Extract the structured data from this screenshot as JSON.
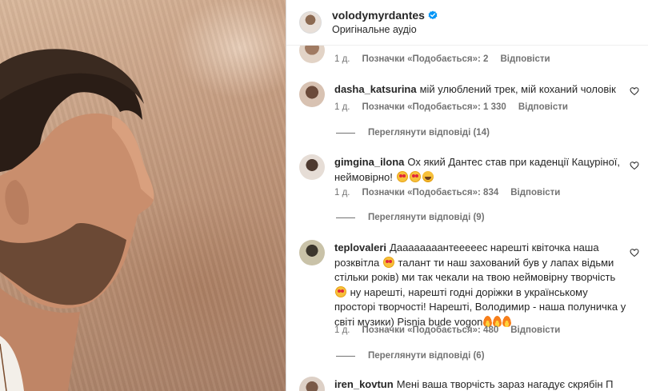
{
  "post": {
    "username": "volodymyrdantes",
    "subtitle": "Оригінальне аудіо"
  },
  "labels": {
    "time": "1 д.",
    "reply": "Відповісти"
  },
  "top_partial": {
    "likes": "Позначки «Подобається»: 2"
  },
  "comments": [
    {
      "username": "dasha_katsurina",
      "text": "мій улюблений трек, мій коханий чоловік",
      "time": "1 д.",
      "likes": "Позначки «Подобається»: 1 330",
      "reply": "Відповісти",
      "view_replies": "Переглянути відповіді (14)"
    },
    {
      "username": "gimgina_ilona",
      "text": "Ох який Дантес став при каденції Кацуріної, неймовірно!",
      "emoji": [
        "heart-eyes",
        "heart-eyes",
        "laugh"
      ],
      "time": "1 д.",
      "likes": "Позначки «Подобається»: 834",
      "reply": "Відповісти",
      "view_replies": "Переглянути відповіді (9)"
    },
    {
      "username": "teplovaleri",
      "text_1": "Даааааааантееееес нарешті квіточка наша розквітла",
      "text_2": "талант ти наш захований був у лапах відьми стільки років) ми так чекали на твою неймовірну творчість",
      "text_3": "ну нарешті, нарешті годні доріжки в українському просторі творчості! Нарешті, Володимир - наша полуничка у світі музики) Pisnia bude vogon",
      "time": "1 д.",
      "likes": "Позначки «Подобається»: 480",
      "reply": "Відповісти",
      "view_replies": "Переглянути відповіді (6)"
    },
    {
      "username": "iren_kovtun",
      "text": "Мені ваша творчість зараз нагадує скрябін П"
    }
  ],
  "colors": {
    "text": "#262626",
    "secondary": "#737373",
    "verified": "#0095f6",
    "border": "#dbdbdb"
  },
  "icons": {
    "verified": "verified-badge-icon",
    "like": "heart-icon"
  }
}
